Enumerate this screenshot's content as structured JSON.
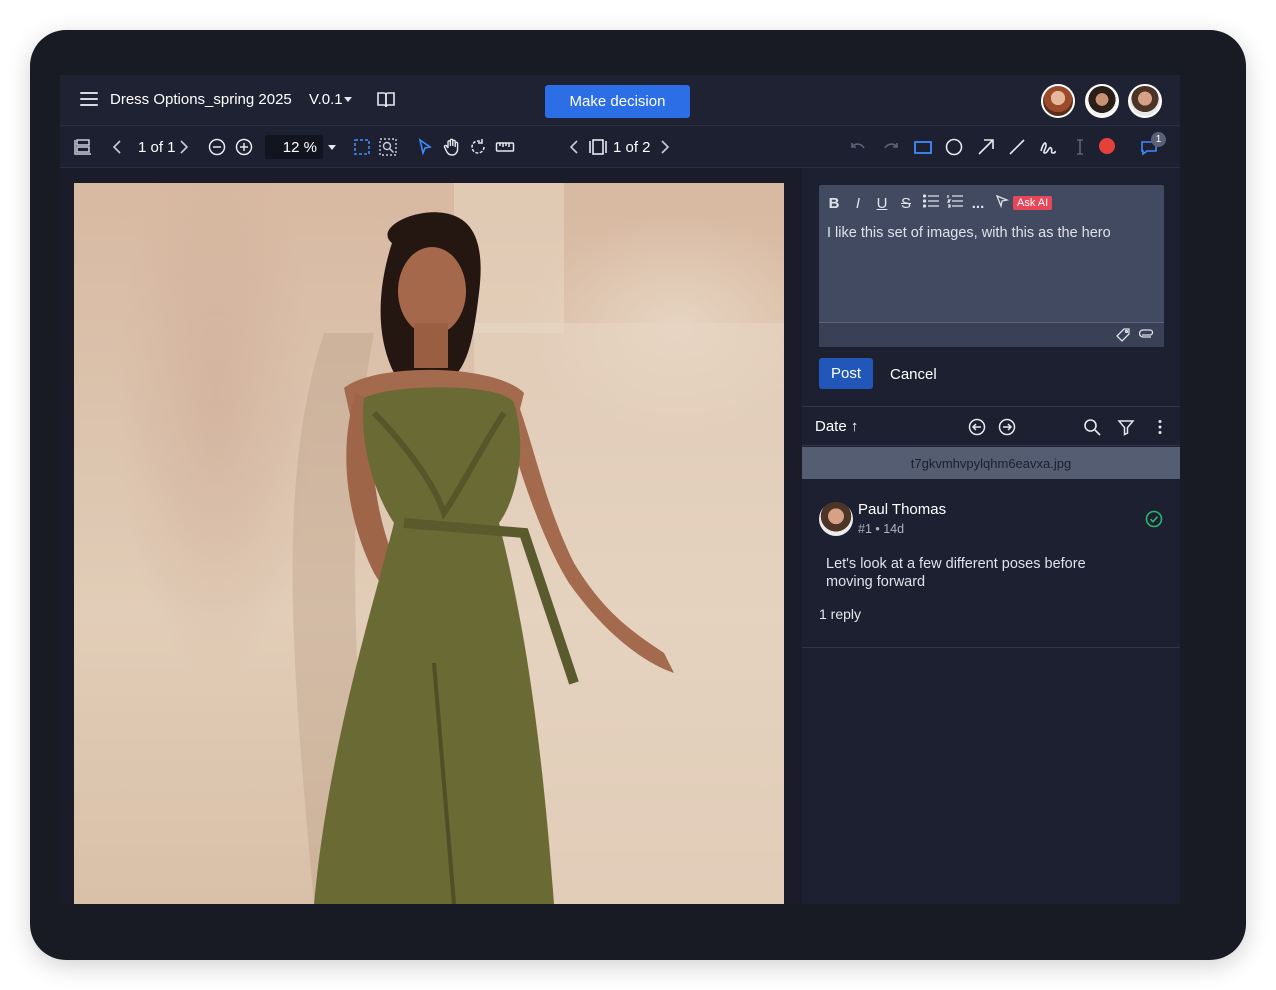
{
  "header": {
    "doc_title": "Dress Options_spring 2025",
    "version": "V.0.1",
    "make_decision": "Make decision"
  },
  "toolbar": {
    "page_counter": "1 of 1",
    "zoom": "12 %",
    "frame_counter": "1 of 2",
    "notification_count": "1"
  },
  "editor": {
    "tools": [
      "B",
      "I",
      "U",
      "S"
    ],
    "more": "...",
    "ask_ai": "Ask AI",
    "text": "I like this set of images, with this as the hero"
  },
  "actions": {
    "post": "Post",
    "cancel": "Cancel"
  },
  "sort": {
    "label": "Date",
    "arrow": "↑"
  },
  "file": {
    "name": "t7gkvmhvpylqhm6eavxa.jpg"
  },
  "comment": {
    "author": "Paul Thomas",
    "meta": "#1 • 14d",
    "body": "Let's look at a few different poses before moving forward",
    "replies": "1 reply"
  },
  "colors": {
    "accent": "#2c6ee6",
    "post": "#2057b8",
    "resolved": "#2bb673",
    "record": "#e5413b",
    "ask_ai": "#e8475a"
  }
}
